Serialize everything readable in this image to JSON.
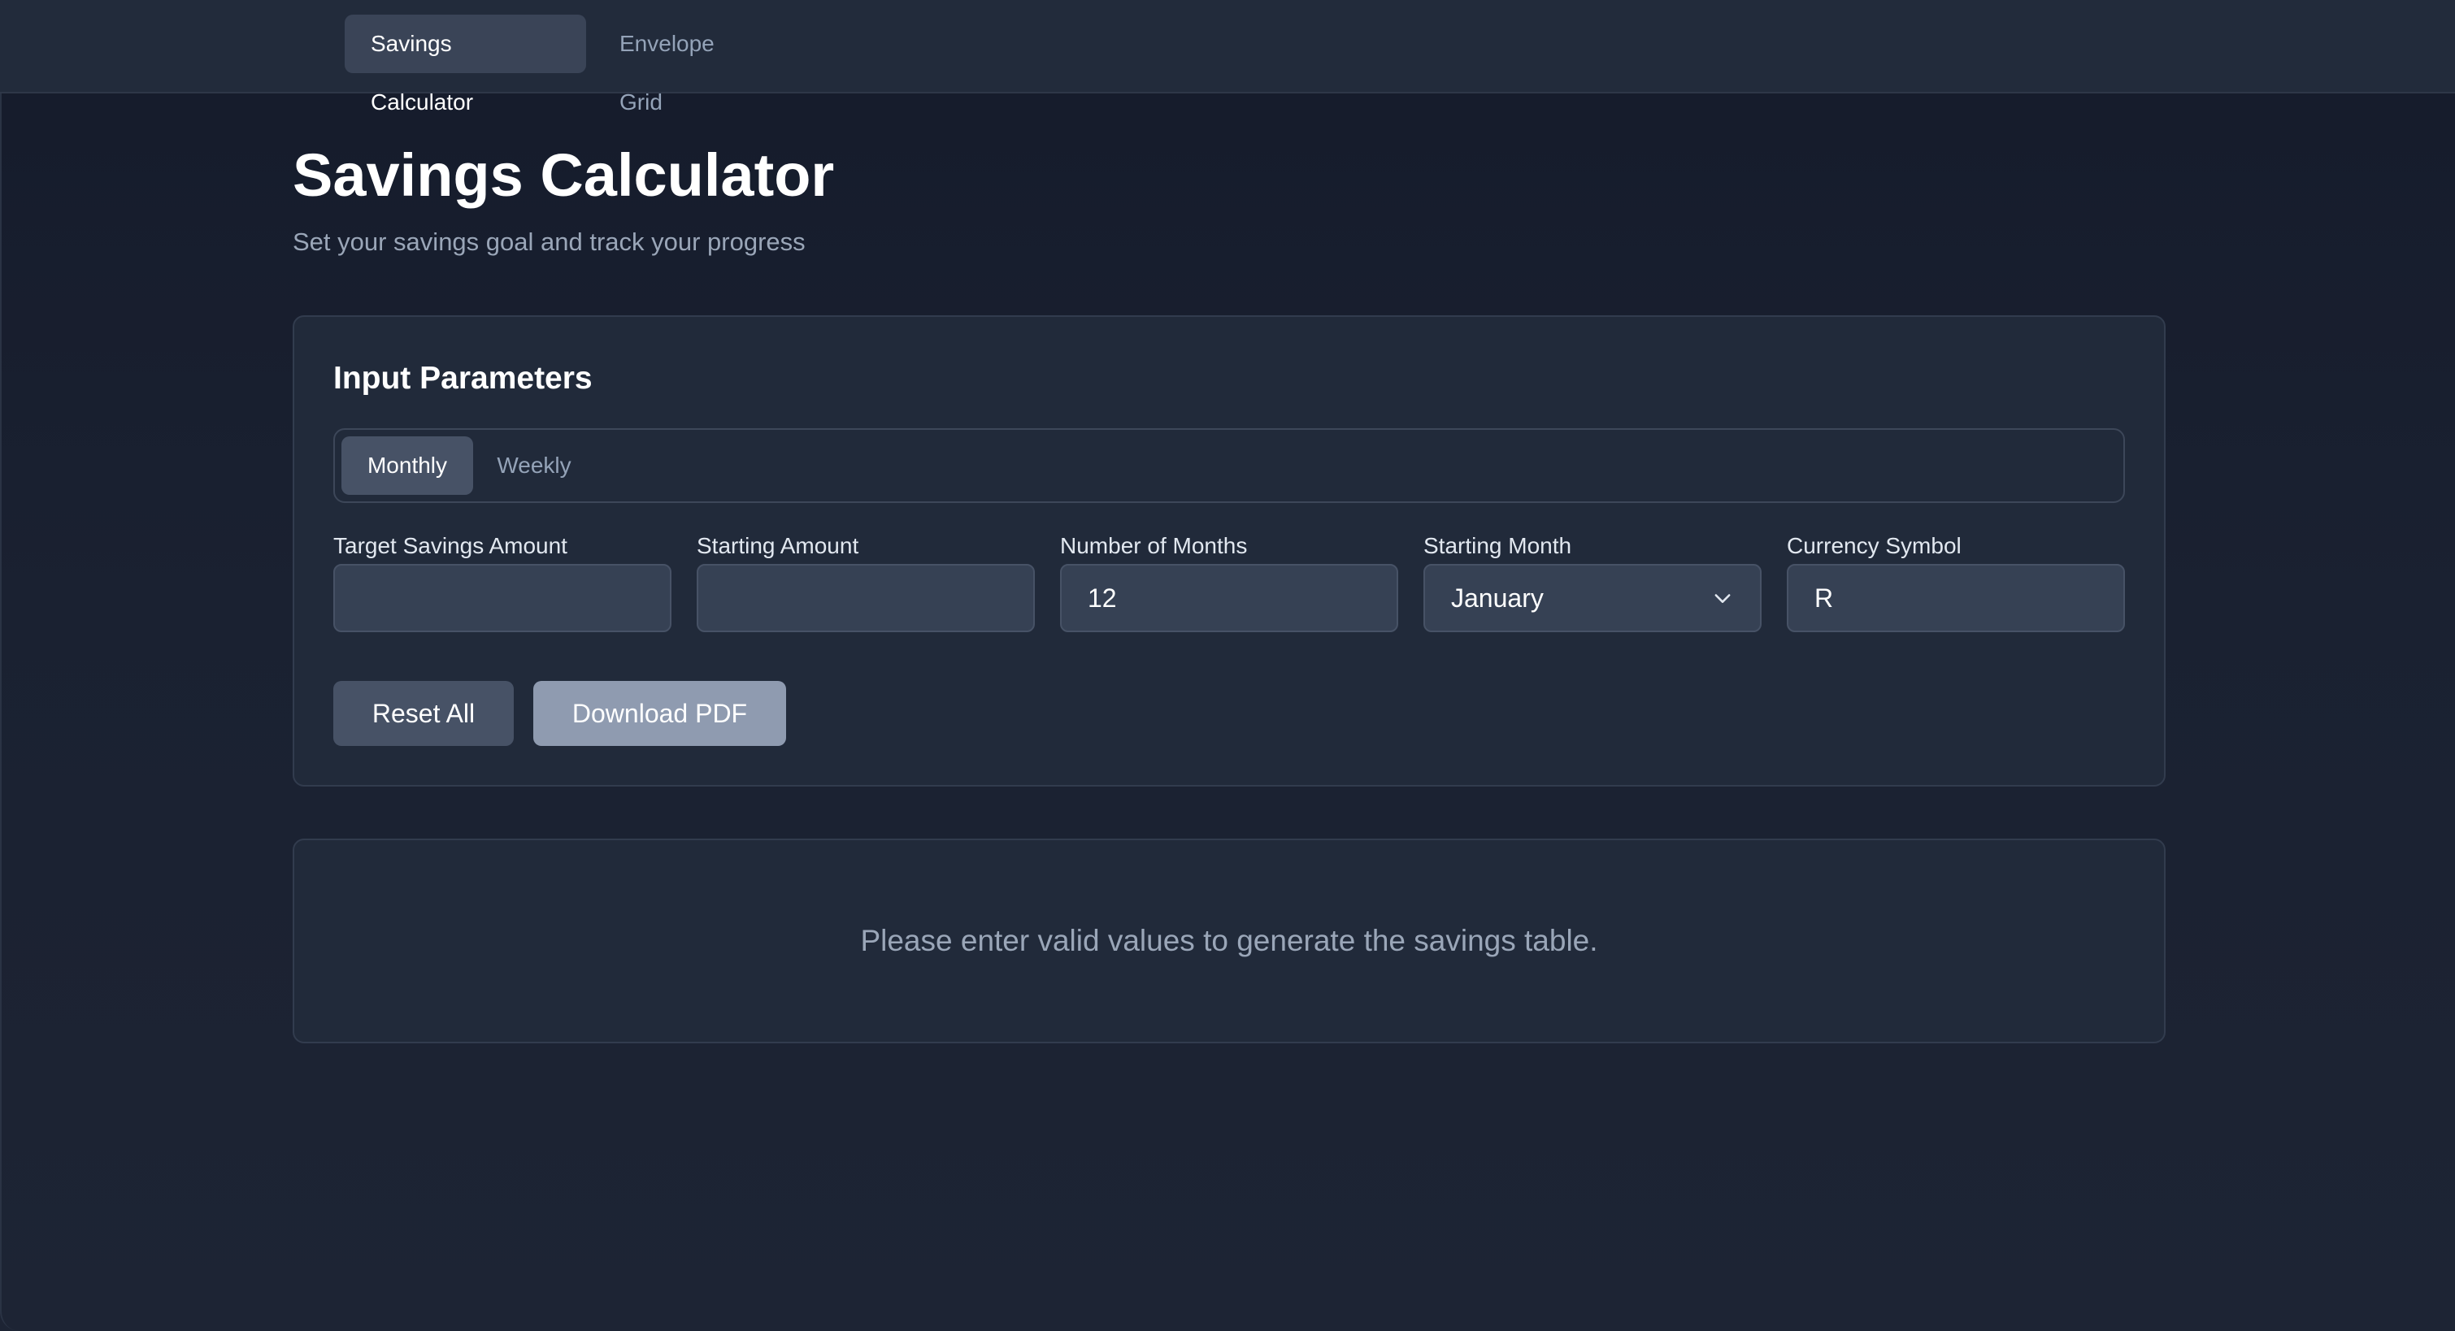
{
  "nav": {
    "tabs": [
      {
        "label": "Savings Calculator",
        "active": true
      },
      {
        "label": "Envelope Grid",
        "active": false
      }
    ]
  },
  "header": {
    "title": "Savings Calculator",
    "subtitle": "Set your savings goal and track your progress"
  },
  "params": {
    "title": "Input Parameters",
    "frequency": {
      "options": [
        "Monthly",
        "Weekly"
      ],
      "selected": "Monthly"
    },
    "fields": {
      "target": {
        "label": "Target Savings Amount",
        "value": ""
      },
      "starting": {
        "label": "Starting Amount",
        "value": ""
      },
      "months": {
        "label": "Number of Months",
        "value": "12"
      },
      "start_month": {
        "label": "Starting Month",
        "value": "January"
      },
      "currency": {
        "label": "Currency Symbol",
        "value": "R"
      }
    },
    "buttons": {
      "reset": "Reset All",
      "download": "Download PDF"
    }
  },
  "result": {
    "message": "Please enter valid values to generate the savings table."
  },
  "colors": {
    "background": "#151b2b",
    "card": "#212a3a",
    "input": "#364154",
    "primary_button": "#475266",
    "disabled_button": "#8f9bb0"
  },
  "icons": {
    "select_indicator": "chevron-down-icon"
  }
}
